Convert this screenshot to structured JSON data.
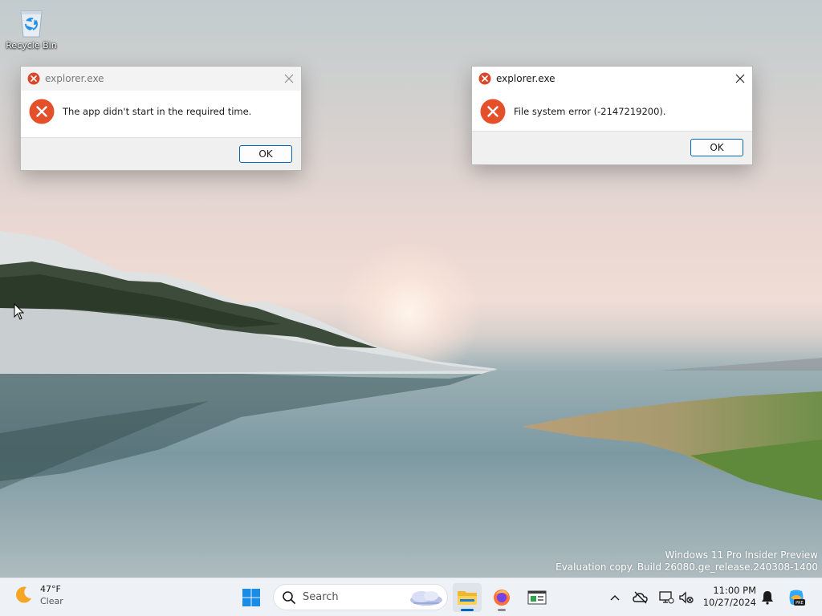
{
  "desktop": {
    "icons": [
      {
        "label": "Recycle Bin",
        "icon": "recycle-bin-icon"
      }
    ],
    "watermark": {
      "line1": "Windows 11 Pro Insider Preview",
      "line2": "Evaluation copy. Build 26080.ge_release.240308-1400"
    }
  },
  "dialogs": [
    {
      "title": "explorer.exe",
      "message": "The app didn't start in the required time.",
      "ok_label": "OK",
      "icon": "error-icon",
      "state": "inactive"
    },
    {
      "title": "explorer.exe",
      "message": "File system error (-2147219200).",
      "ok_label": "OK",
      "icon": "error-icon",
      "state": "active"
    }
  ],
  "taskbar": {
    "weather": {
      "temperature": "47°F",
      "condition": "Clear",
      "icon": "moon-icon"
    },
    "search": {
      "placeholder": "Search"
    },
    "apps": [
      {
        "name": "File Explorer",
        "icon": "file-explorer-icon",
        "active": true
      },
      {
        "name": "Firefox",
        "icon": "firefox-icon",
        "running": true
      },
      {
        "name": "Task Manager",
        "icon": "task-manager-icon",
        "running": false
      }
    ],
    "tray": {
      "icons": [
        "chevron-up-icon",
        "onedrive-offline-icon",
        "network-icon",
        "volume-muted-icon"
      ],
      "time": "11:00 PM",
      "date": "10/27/2024",
      "notification_icon": "bell-icon",
      "copilot_icon": "copilot-pre-icon",
      "copilot_badge": "PRE"
    }
  },
  "colors": {
    "accent": "#0067c0",
    "error": "#e8461f",
    "taskbar_bg": "#eef1f5"
  }
}
